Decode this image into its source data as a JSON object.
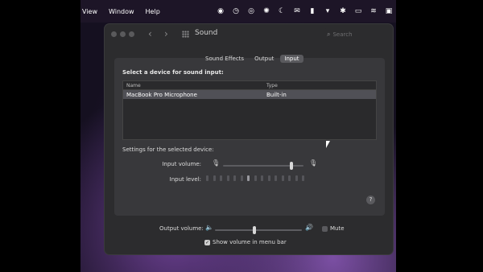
{
  "menubar": {
    "items": [
      "View",
      "Window",
      "Help"
    ],
    "status_icons": [
      "record-icon",
      "clock-icon",
      "circle-icon",
      "badge-icon",
      "moon-icon",
      "mail-icon",
      "controls-icon",
      "shield-icon",
      "bluetooth-icon",
      "battery-icon",
      "wifi-icon",
      "user-icon"
    ]
  },
  "window": {
    "title": "Sound",
    "search_placeholder": "Search",
    "tabs": [
      {
        "label": "Sound Effects",
        "active": false
      },
      {
        "label": "Output",
        "active": false
      },
      {
        "label": "Input",
        "active": true
      }
    ]
  },
  "input": {
    "select_title": "Select a device for sound input:",
    "table": {
      "headers": [
        "Name",
        "Type"
      ],
      "rows": [
        {
          "name": "MacBook Pro Microphone",
          "type": "Built-in"
        }
      ]
    },
    "settings_label": "Settings for the selected device:",
    "input_volume_label": "Input volume:",
    "input_volume_level": 0.85,
    "input_level_label": "Input level:",
    "input_level_segments": 15,
    "input_level_active": 6
  },
  "output": {
    "volume_label": "Output volume:",
    "volume_level": 0.45,
    "mute_label": "Mute",
    "mute_checked": false,
    "show_volume_label": "Show volume in menu bar",
    "show_volume_checked": true
  },
  "help_label": "?"
}
